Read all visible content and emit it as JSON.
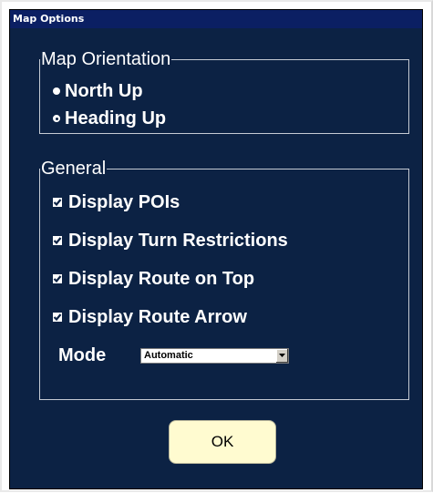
{
  "window": {
    "title": "Map Options"
  },
  "map_orientation": {
    "legend": "Map Orientation",
    "options": [
      {
        "label": "North Up",
        "selected": false
      },
      {
        "label": "Heading Up",
        "selected": true
      }
    ]
  },
  "general": {
    "legend": "General",
    "checkboxes": [
      {
        "label": "Display POIs",
        "checked": true
      },
      {
        "label": "Display Turn Restrictions",
        "checked": true
      },
      {
        "label": "Display Route on Top",
        "checked": true
      },
      {
        "label": "Display Route Arrow",
        "checked": true
      }
    ],
    "mode": {
      "label": "Mode",
      "value": "Automatic"
    }
  },
  "buttons": {
    "ok_label": "OK"
  },
  "colors": {
    "dialog_background": "#0c2244",
    "titlebar_background": "#0b1f63",
    "text": "#ffffff",
    "group_border": "#c6cbd4",
    "ok_button_background": "#fffbd0"
  }
}
